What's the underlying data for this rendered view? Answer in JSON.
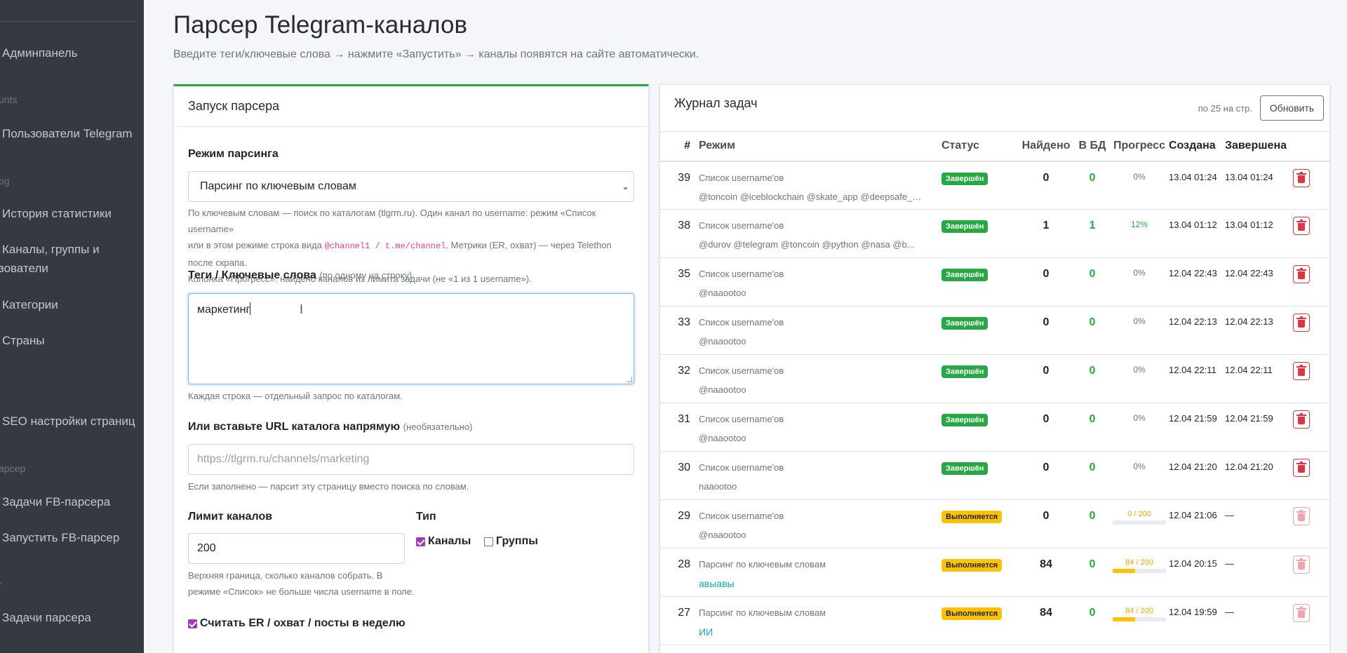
{
  "sidebar": {
    "items": [
      {
        "label": "Админпанель"
      },
      {
        "label": "Пользователи Telegram"
      },
      {
        "label": "История статистики"
      },
      {
        "label": "Каналы, группы и"
      },
      {
        "label": "зователи"
      },
      {
        "label": "Категории"
      },
      {
        "label": "Страны"
      },
      {
        "label": "SEO настройки страниц"
      },
      {
        "label": "Задачи FB-парсера"
      },
      {
        "label": "Запустить FB-парсер"
      },
      {
        "label": "Задачи парсера"
      }
    ],
    "headers": [
      "unts",
      "og",
      "арсер",
      "r"
    ]
  },
  "page": {
    "title": "Парсер Telegram-каналов",
    "subtitle": "Введите теги/ключевые слова → нажмите «Запустить» → каналы появятся на сайте автоматически."
  },
  "launch": {
    "title": "Запуск парсера",
    "mode_label": "Режим парсинга",
    "mode_value": "Парсинг по ключевым словам",
    "mode_help_1": "По ключевым словам — поиск по каталогам (tlgrm.ru). Один канал по username: режим «Список username»",
    "mode_help_2a": "или в этом режиме строка вида ",
    "mode_help_code1": "@channel1",
    "mode_help_sep": " / ",
    "mode_help_code2": "t.me/channel",
    "mode_help_2b": ". Метрики (ER, охват) — через Telethon после скрапа.",
    "mode_help_3": "Колонка «Прогресс»: найдено каналов из лимита задачи (не «1 из 1 username»).",
    "tags_label": "Теги / Ключевые слова",
    "tags_hint": "(по одному на строку)",
    "tags_value": "маркетинг",
    "tags_help": "Каждая строка — отдельный запрос по каталогам.",
    "url_label": "Или вставьте URL каталога напрямую",
    "url_hint": "(необязательно)",
    "url_placeholder": "https://tlgrm.ru/channels/marketing",
    "url_help": "Если заполнено — парсит эту страницу вместо поиска по словам.",
    "limit_label": "Лимит каналов",
    "limit_value": "200",
    "limit_help_1": "Верхняя граница, сколько каналов собрать. В",
    "limit_help_2": "режиме «Список» не больше числа username в поле.",
    "type_label": "Тип",
    "type_channels": "Каналы",
    "type_groups": "Группы",
    "er_label": "Считать ER / охват / посты в неделю"
  },
  "journal": {
    "title": "Журнал задач",
    "per_page": "по 25 на стр.",
    "refresh": "Обновить",
    "columns": [
      "#",
      "Режим",
      "Статус",
      "Найдено",
      "В БД",
      "Прогресс",
      "Создана",
      "Завершена"
    ],
    "rows": [
      {
        "id": "39",
        "mode": "Список username'ов",
        "detail": "@toncoin @iceblockchain @skate_app @deepsafe_of...",
        "status": "Завершён",
        "found": "0",
        "db": "0",
        "progress": "0%",
        "created": "13.04 01:24",
        "done": "13.04 01:24"
      },
      {
        "id": "38",
        "mode": "Список username'ов",
        "detail": "@durov @telegram @toncoin @python @nasa @b...",
        "status": "Завершён",
        "found": "1",
        "db": "1",
        "progress": "12%",
        "created": "13.04 01:12",
        "done": "13.04 01:12"
      },
      {
        "id": "35",
        "mode": "Список username'ов",
        "detail": "@naaootoo",
        "status": "Завершён",
        "found": "0",
        "db": "0",
        "progress": "0%",
        "created": "12.04 22:43",
        "done": "12.04 22:43"
      },
      {
        "id": "33",
        "mode": "Список username'ов",
        "detail": "@naaootoo",
        "status": "Завершён",
        "found": "0",
        "db": "0",
        "progress": "0%",
        "created": "12.04 22:13",
        "done": "12.04 22:13"
      },
      {
        "id": "32",
        "mode": "Список username'ов",
        "detail": "@naaootoo",
        "status": "Завершён",
        "found": "0",
        "db": "0",
        "progress": "0%",
        "created": "12.04 22:11",
        "done": "12.04 22:11"
      },
      {
        "id": "31",
        "mode": "Список username'ов",
        "detail": "@naaootoo",
        "status": "Завершён",
        "found": "0",
        "db": "0",
        "progress": "0%",
        "created": "12.04 21:59",
        "done": "12.04 21:59"
      },
      {
        "id": "30",
        "mode": "Список username'ов",
        "detail": "naaootoo",
        "status": "Завершён",
        "found": "0",
        "db": "0",
        "progress": "0%",
        "created": "12.04 21:20",
        "done": "12.04 21:20"
      },
      {
        "id": "29",
        "mode": "Список username'ов",
        "detail": "@naaootoo",
        "status": "Выполняется",
        "found": "0",
        "db": "0",
        "progress": "0 / 200",
        "progress_fraction": 0.0,
        "created": "12.04 21:06",
        "done": "—"
      },
      {
        "id": "28",
        "mode": "Парсинг по ключевым словам",
        "detail": "авыавы",
        "status": "Выполняется",
        "found": "84",
        "db": "0",
        "progress": "84 / 200",
        "progress_fraction": 0.42,
        "created": "12.04 20:15",
        "done": "—"
      },
      {
        "id": "27",
        "mode": "Парсинг по ключевым словам",
        "detail": "ИИ",
        "status": "Выполняется",
        "found": "84",
        "db": "0",
        "progress": "84 / 200",
        "progress_fraction": 0.42,
        "created": "12.04 19:59",
        "done": "—"
      }
    ]
  }
}
